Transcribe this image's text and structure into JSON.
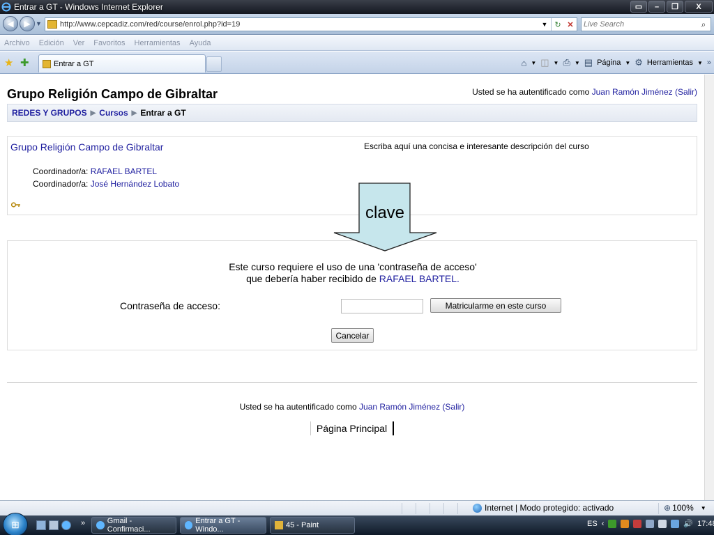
{
  "window": {
    "title": "Entrar a GT - Windows Internet Explorer"
  },
  "addressbar": {
    "url": "http://www.cepcadiz.com/red/course/enrol.php?id=19",
    "search_placeholder": "Live Search"
  },
  "menu": {
    "items": [
      "Archivo",
      "Edición",
      "Ver",
      "Favoritos",
      "Herramientas",
      "Ayuda"
    ]
  },
  "tab": {
    "label": "Entrar a GT"
  },
  "commandbar": {
    "page_label": "Página",
    "tools_label": "Herramientas"
  },
  "page": {
    "site_title": "Grupo Religión Campo de Gibraltar",
    "login_prefix": "Usted se ha autentificado como",
    "user_name": "Juan Ramón Jiménez",
    "logout_label": "(Salir)",
    "breadcrumb": {
      "root": "REDES Y GRUPOS",
      "section": "Cursos",
      "current": "Entrar a GT"
    },
    "course": {
      "name": "Grupo Religión Campo de Gibraltar",
      "description": "Escriba aquí una concisa e interesante descripción del curso",
      "coordinator_label": "Coordinador/a:",
      "coordinators": [
        "RAFAEL BARTEL",
        "José Hernández Lobato"
      ]
    },
    "enrol": {
      "line1": "Este curso requiere el uso de una 'contraseña de acceso'",
      "line2_prefix": "que debería haber recibido de",
      "line2_name": "RAFAEL BARTEL.",
      "password_label": "Contraseña de acceso:",
      "password_value": "",
      "enrol_button": "Matricularme en este curso",
      "cancel_button": "Cancelar"
    },
    "callout_label": "clave",
    "home_link": "Página Principal"
  },
  "statusbar": {
    "zone": "Internet | Modo protegido: activado",
    "zoom": "100%"
  },
  "taskbar": {
    "items": [
      "Gmail - Confirmaci...",
      "Entrar a GT - Windo...",
      "45 - Paint"
    ],
    "lang": "ES",
    "time": "17:48"
  }
}
